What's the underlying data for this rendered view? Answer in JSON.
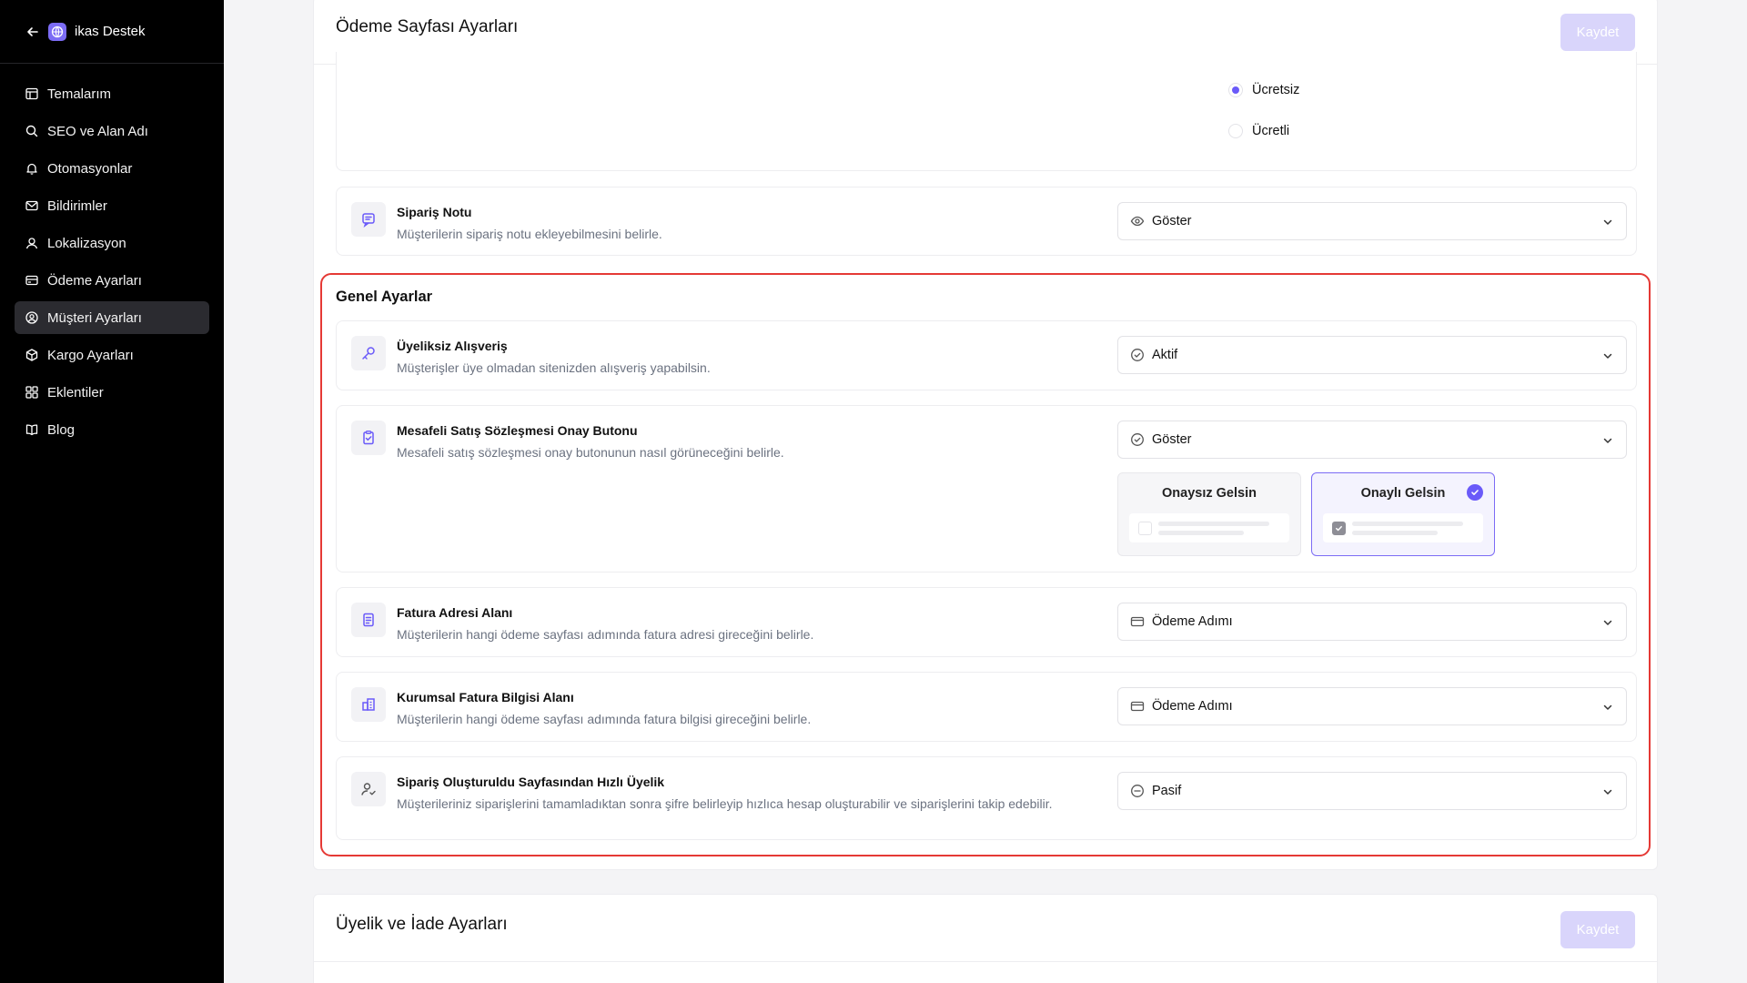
{
  "sidebar": {
    "title": "ikas Destek",
    "items": [
      {
        "label": "Temalarım",
        "icon": "layout-icon",
        "active": false
      },
      {
        "label": "SEO ve Alan Adı",
        "icon": "search-icon",
        "active": false
      },
      {
        "label": "Otomasyonlar",
        "icon": "bell-icon",
        "active": false
      },
      {
        "label": "Bildirimler",
        "icon": "mail-icon",
        "active": false
      },
      {
        "label": "Lokalizasyon",
        "icon": "user-pin-icon",
        "active": false
      },
      {
        "label": "Ödeme Ayarları",
        "icon": "credit-card-icon",
        "active": false
      },
      {
        "label": "Müşteri Ayarları",
        "icon": "user-circle-icon",
        "active": true
      },
      {
        "label": "Kargo Ayarları",
        "icon": "package-icon",
        "active": false
      },
      {
        "label": "Eklentiler",
        "icon": "grid-icon",
        "active": false
      },
      {
        "label": "Blog",
        "icon": "book-icon",
        "active": false
      }
    ]
  },
  "payment_card": {
    "title": "Ödeme Sayfası Ayarları",
    "save_label": "Kaydet",
    "radio_options": [
      {
        "label": "Ücretsiz",
        "selected": true
      },
      {
        "label": "Ücretli",
        "selected": false
      }
    ],
    "order_note": {
      "title": "Sipariş Notu",
      "desc": "Müşterilerin sipariş notu ekleyebilmesini belirle.",
      "value": "Göster"
    }
  },
  "general": {
    "title": "Genel Ayarlar",
    "guest": {
      "title": "Üyeliksiz Alışveriş",
      "desc": "Müşterişler üye olmadan sitenizden alışveriş yapabilsin.",
      "value": "Aktif"
    },
    "contract": {
      "title": "Mesafeli Satış Sözleşmesi Onay Butonu",
      "desc": "Mesafeli satış sözleşmesi onay butonunun nasıl görüneceğini belirle.",
      "value": "Göster",
      "options": [
        {
          "label": "Onaysız Gelsin",
          "selected": false
        },
        {
          "label": "Onaylı Gelsin",
          "selected": true
        }
      ]
    },
    "invoice_address": {
      "title": "Fatura Adresi Alanı",
      "desc": "Müşterilerin hangi ödeme sayfası adımında fatura adresi gireceğini belirle.",
      "value": "Ödeme Adımı"
    },
    "corporate_invoice": {
      "title": "Kurumsal Fatura Bilgisi Alanı",
      "desc": "Müşterilerin hangi ödeme sayfası adımında fatura bilgisi gireceğini belirle.",
      "value": "Ödeme Adımı"
    },
    "quick_membership": {
      "title": "Sipariş Oluşturuldu Sayfasından Hızlı Üyelik",
      "desc": "Müşterileriniz siparişlerini tamamladıktan sonra şifre belirleyip hızlıca hesap oluşturabilir ve siparişlerini takip edebilir.",
      "value": "Pasif"
    }
  },
  "membership_card": {
    "title": "Üyelik ve İade Ayarları",
    "save_label": "Kaydet"
  },
  "colors": {
    "accent": "#6a5af9",
    "highlight_border": "#e53935",
    "sidebar_bg": "#000000"
  }
}
